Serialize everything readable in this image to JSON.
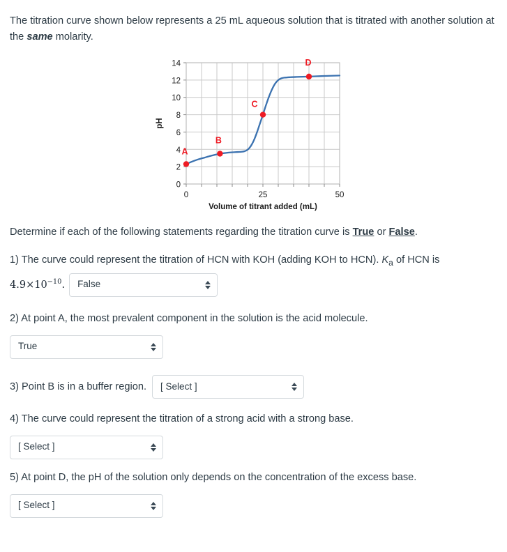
{
  "intro": {
    "part1": "The titration curve shown below represents a 25 mL aqueous solution that is titrated with another solution at the ",
    "emphasis": "same",
    "part2": " molarity."
  },
  "determine": {
    "prefix": "Determine if each of the following statements regarding the titration curve is ",
    "true_word": "True",
    "middle": " or ",
    "false_word": "False",
    "suffix": "."
  },
  "chart_data": {
    "type": "line",
    "title": "",
    "xlabel": "Volume of titrant added (mL)",
    "ylabel": "pH",
    "xlim": [
      0,
      50
    ],
    "ylim": [
      0,
      14
    ],
    "xticks": [
      0,
      25,
      50
    ],
    "xtick_labels": [
      "0",
      "25",
      "50"
    ],
    "xminor_step": 5,
    "yticks": [
      0,
      2,
      4,
      6,
      8,
      10,
      12,
      14
    ],
    "ytick_labels": [
      "0",
      "2",
      "4",
      "6",
      "8",
      "10",
      "12",
      "14"
    ],
    "grid": true,
    "legend": "none",
    "line_color": "#3b72b0",
    "marker_color": "#ee1c25",
    "label_color": "#ee1c25",
    "x": [
      0,
      2,
      4,
      6,
      8,
      10,
      11,
      12,
      14,
      16,
      18,
      19,
      20,
      21,
      22,
      23,
      24,
      25,
      26,
      27,
      28,
      29,
      30,
      31,
      32,
      34,
      36,
      38,
      40,
      42,
      45,
      48,
      50
    ],
    "y": [
      2.3,
      2.6,
      2.85,
      3.05,
      3.25,
      3.42,
      3.5,
      3.55,
      3.63,
      3.68,
      3.72,
      3.78,
      3.95,
      4.35,
      5.0,
      5.9,
      6.95,
      8.0,
      9.1,
      10.1,
      10.95,
      11.6,
      12.0,
      12.2,
      12.28,
      12.33,
      12.36,
      12.38,
      12.4,
      12.43,
      12.47,
      12.5,
      12.52
    ],
    "annotated_points": [
      {
        "label": "A",
        "x": 0,
        "y": 2.3,
        "label_dx": -2,
        "label_dy": -14
      },
      {
        "label": "B",
        "x": 11,
        "y": 3.5,
        "label_dx": -2,
        "label_dy": -15
      },
      {
        "label": "C",
        "x": 25,
        "y": 8.0,
        "label_dx": -12,
        "label_dy": -11
      },
      {
        "label": "D",
        "x": 40,
        "y": 12.4,
        "label_dx": -1,
        "label_dy": -16
      }
    ]
  },
  "questions": [
    {
      "number": "1)",
      "text_line1": "1) The curve could represent the titration of HCN with KOH (adding KOH to HCN). ",
      "ka_italic": "K",
      "ka_sub": "a",
      "text_line1_tail": " of HCN is",
      "math_mantissa": "4.9",
      "math_times": "×",
      "math_base": "10",
      "math_exp": "−10",
      "math_period": ".",
      "select_value": "False"
    },
    {
      "number": "2)",
      "text": "2) At point A, the most prevalent component in the solution is the acid molecule.",
      "select_value": "True"
    },
    {
      "number": "3)",
      "text": "3) Point B is in a buffer region.",
      "select_value": "[ Select ]"
    },
    {
      "number": "4)",
      "text": "4) The curve could represent the titration of a strong acid with a strong base.",
      "select_value": "[ Select ]"
    },
    {
      "number": "5)",
      "text": "5) At point D, the pH of the solution only depends on the concentration of the excess base.",
      "select_value": "[ Select ]"
    }
  ]
}
